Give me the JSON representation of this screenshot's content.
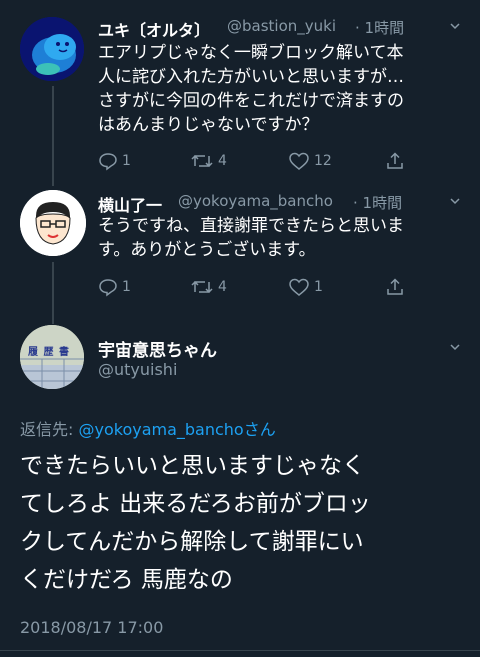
{
  "tweets": [
    {
      "name": "ユキ〔オルタ〕",
      "handle": "@bastion_yuki",
      "time": "· 1時間",
      "lines": [
        "エアリプじゃなく一瞬ブロック解いて本",
        "人に詫び入れた方がいいと思いますが…",
        "さすがに今回の件をこれだけで済ますの",
        "はあんまりじゃないですか？"
      ],
      "replies": "1",
      "retweets": "4",
      "likes": "12"
    },
    {
      "name": "横山了一",
      "handle": "@yokoyama_bancho",
      "time": "· 1時間",
      "lines": [
        "そうですね、直接謝罪できたらと思いま",
        "す。ありがとうございます。"
      ],
      "replies": "1",
      "retweets": "4",
      "likes": "1"
    }
  ],
  "main": {
    "name": "宇宙意思ちゃん",
    "handle": "@utyuishi",
    "avatar_text": "履 歴 書",
    "reply_prefix": "返信先: ",
    "reply_to": "@yokoyama_bancho",
    "reply_suffix": "さん",
    "lines": [
      "できたらいいと思いますじゃなく",
      "てしろよ 出来るだろお前がブロッ",
      "クしてんだから解除して謝罪にい",
      "くだけだろ 馬鹿なの"
    ],
    "timestamp": "2018/08/17 17:00"
  },
  "colors": {
    "background": "#15202b",
    "muted": "#8899a6",
    "link": "#1da1f2",
    "divider": "#38444d"
  }
}
